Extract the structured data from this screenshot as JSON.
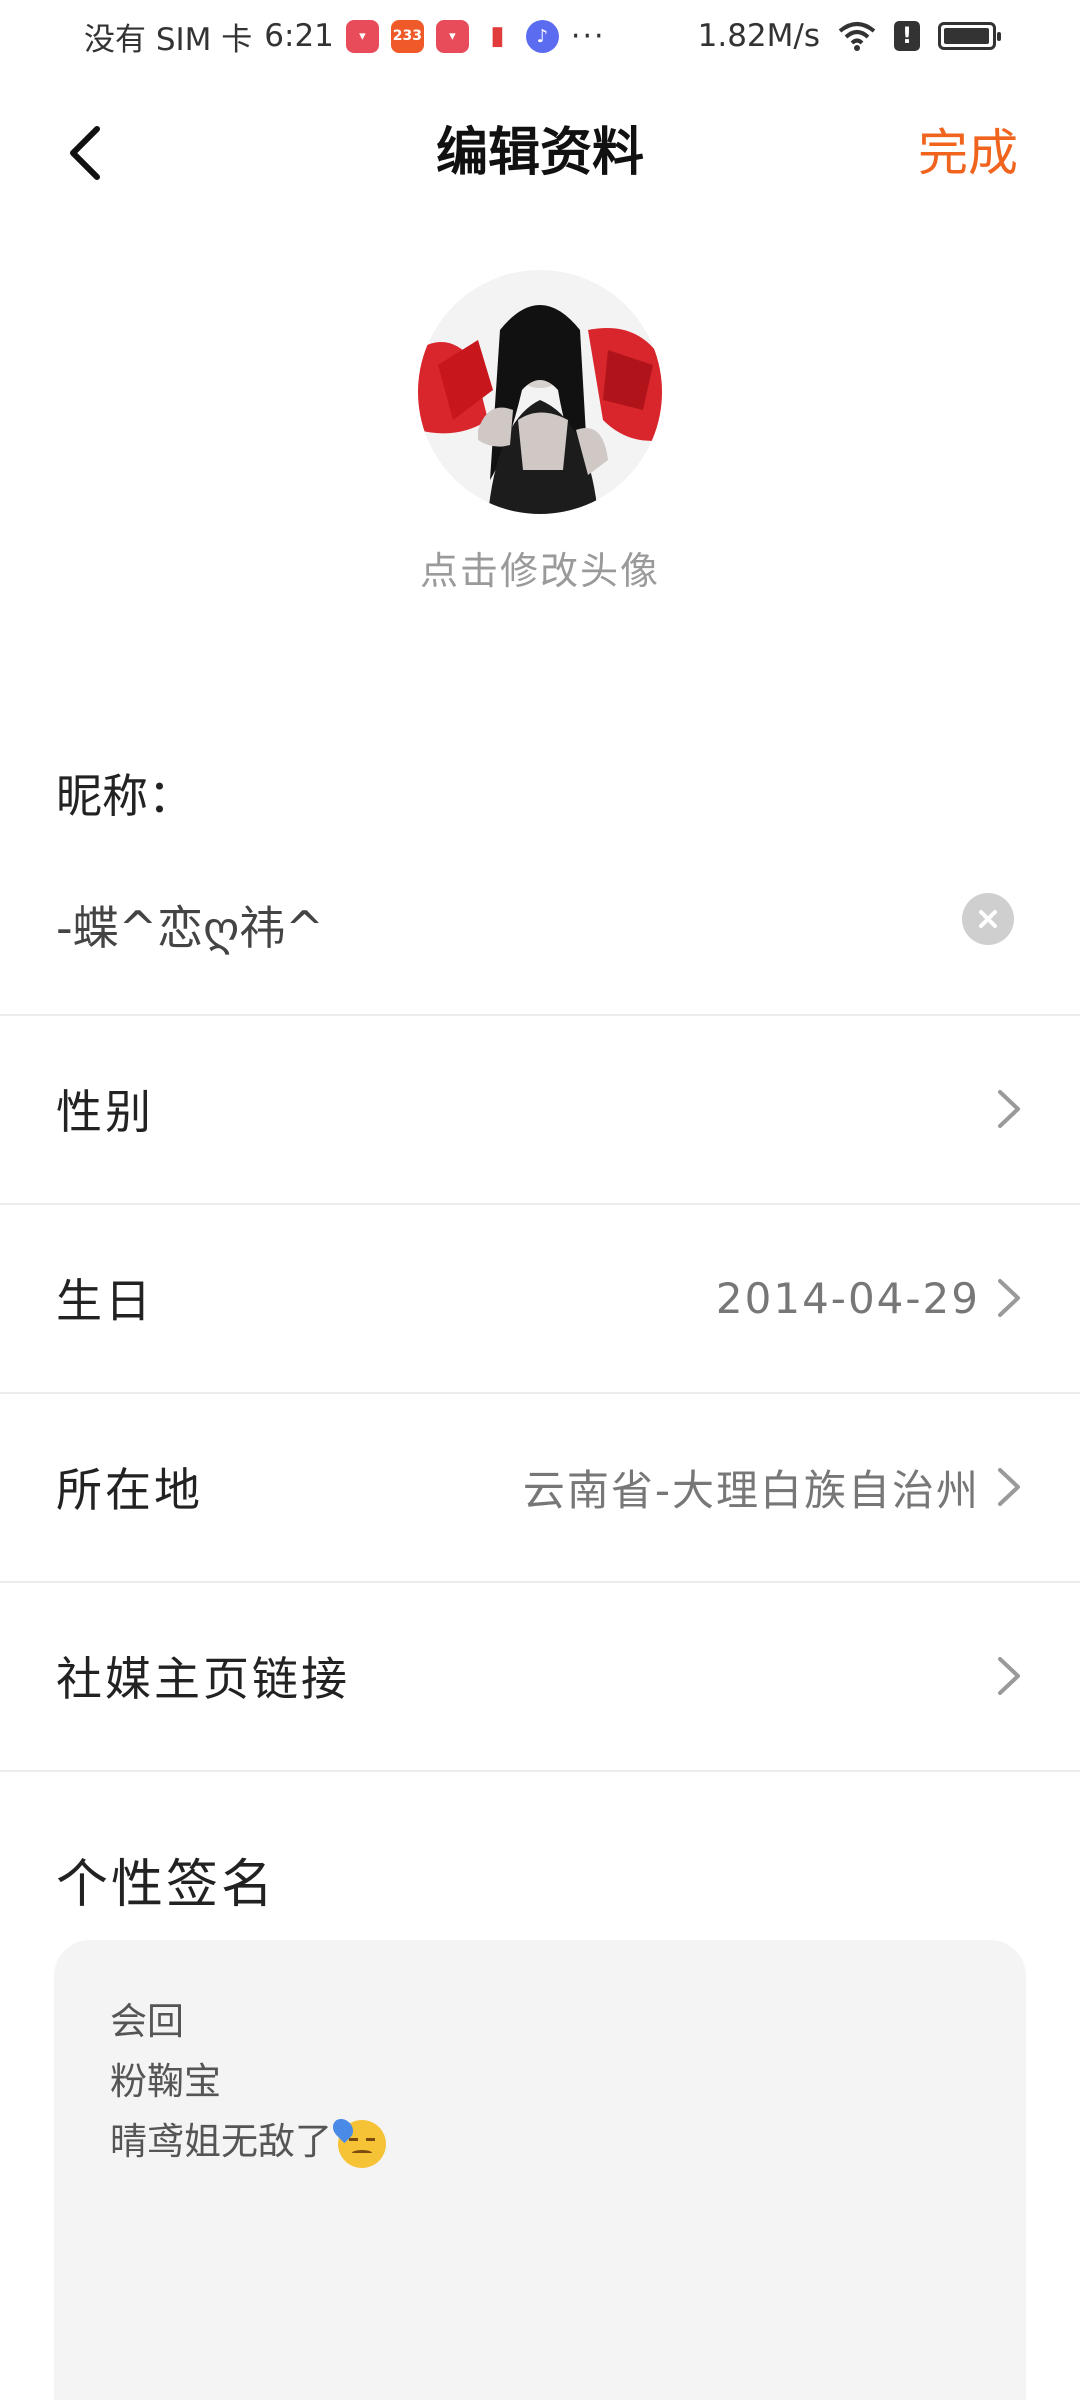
{
  "status_bar": {
    "carrier": "没有 SIM 卡",
    "time": "6:21",
    "notif_icons": [
      "huawei-store-icon",
      "bilibili-233-icon",
      "huawei-store-icon",
      "book-icon",
      "music-icon"
    ],
    "notif_233": "233",
    "more_dots": "···",
    "net_speed": "1.82M/s",
    "alert_badge": "!"
  },
  "header": {
    "title": "编辑资料",
    "done_label": "完成"
  },
  "avatar": {
    "hint": "点击修改头像"
  },
  "nickname": {
    "label": "昵称：",
    "value": "-蝶^恋ღ祎^"
  },
  "rows": [
    {
      "label": "性别",
      "value": ""
    },
    {
      "label": "生日",
      "value": "2014-04-29"
    },
    {
      "label": "所在地",
      "value": "云南省-大理白族自治州"
    },
    {
      "label": "社媒主页链接",
      "value": ""
    }
  ],
  "signature": {
    "title": "个性签名",
    "lines": [
      "会回",
      "粉鞠宝",
      "晴鸢姐无敌了"
    ]
  },
  "colors": {
    "accent": "#f0641e",
    "text": "#222222",
    "muted": "#9a9a9a",
    "sig_bg": "#f4f4f4"
  }
}
